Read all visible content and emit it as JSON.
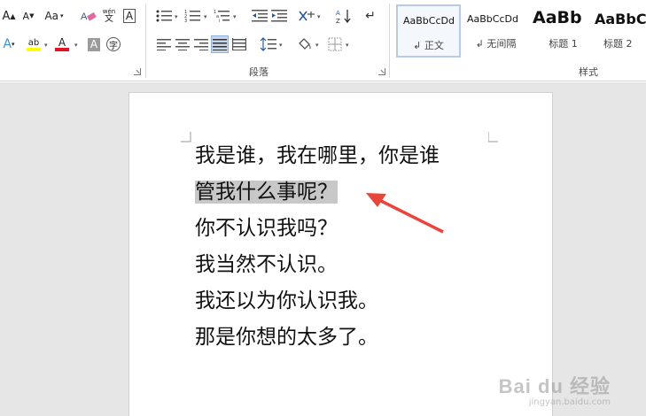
{
  "ribbon": {
    "groups": {
      "paragraph_label": "段落",
      "styles_label": "样式"
    },
    "font": {
      "grow_font_label": "A",
      "shrink_font_label": "A",
      "change_case_label": "Aa",
      "phonetic_top": "wén",
      "phonetic_bottom": "文",
      "char_border_label": "A",
      "text_effect_label": "A",
      "highlight_label": "ab",
      "font_color_label": "A",
      "char_shade_label": "A",
      "enclose_char_label": "字",
      "highlight_color": "#ffff00",
      "font_color": "#e81123"
    },
    "styles": [
      {
        "sample": "AaBbCcDd",
        "name": "↲ 正文"
      },
      {
        "sample": "AaBbCcDd",
        "name": "↲ 无间隔"
      },
      {
        "sample": "AaBb",
        "name": "标题 1"
      },
      {
        "sample": "AaBbC",
        "name": "标题 2"
      }
    ]
  },
  "document": {
    "lines": [
      "我是谁，我在哪里，你是谁",
      "管我什么事呢？",
      "你不认识我吗？",
      "我当然不认识。",
      "我还以为你认识我。",
      "那是你想的太多了。"
    ],
    "highlighted_line_index": 1
  },
  "annotation": {
    "arrow_color": "#e8463a"
  },
  "watermark": {
    "brand": "Bai du 经验",
    "url": "jingyan.baidu.com"
  }
}
